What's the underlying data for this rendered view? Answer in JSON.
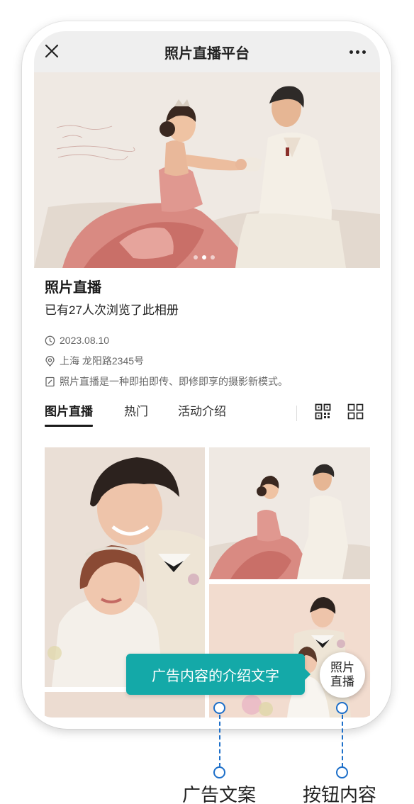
{
  "nav": {
    "title": "照片直播平台",
    "close_icon": "close-icon",
    "more_icon": "more-icon"
  },
  "hero": {
    "photo_icon": "wedding-photo",
    "slides": 3,
    "active_slide": 2
  },
  "album": {
    "title": "照片直播",
    "views": "已有27人次浏览了此相册",
    "date": "2023.08.10",
    "address": "上海 龙阳路2345号",
    "description": "照片直播是一种即拍即传、即修即享的摄影新模式。"
  },
  "tabs": [
    {
      "label": "图片直播",
      "active": true
    },
    {
      "label": "热门",
      "active": false
    },
    {
      "label": "活动介绍",
      "active": false
    }
  ],
  "ad": {
    "banner_text": "广告内容的介绍文字",
    "button_line1": "照片",
    "button_line2": "直播",
    "color": "#14a9a8"
  },
  "annotations": {
    "ad_copy": "广告文案",
    "button_content": "按钮内容",
    "line_color": "#1d6fc9"
  }
}
